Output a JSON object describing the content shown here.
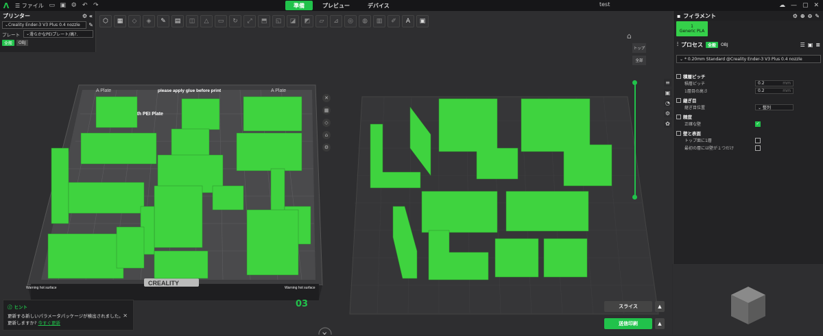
{
  "topbar": {
    "file_menu": "ファイル",
    "tabs": [
      {
        "label": "準備",
        "active": true
      },
      {
        "label": "プレビュー",
        "active": false
      },
      {
        "label": "デバイス",
        "active": false
      }
    ],
    "title": "test"
  },
  "printer": {
    "title": "プリンター",
    "printer_name": "Creality Ender-3 V3 Plus 0.4 nozzle",
    "plate_label": "プレート",
    "plate_value": "滑らかなPEIプレート/高?.",
    "badge_all": "全般",
    "badge_obj": "OBJ"
  },
  "plate": {
    "labels": [
      "A Plate",
      "please apply glue before print",
      "A Plate",
      "Smooth PEI Plate"
    ],
    "brand": "CREALITY",
    "warning_left": "Warning hot surface",
    "warning_right": "Warning hot surface",
    "plate_number": "03"
  },
  "view": {
    "top": "トップ",
    "all": "全部"
  },
  "filament": {
    "title": "フィラメント",
    "slot": "1",
    "name": "Generic PLA"
  },
  "process": {
    "title": "プロセス",
    "badge_all": "全般",
    "badge_obj": "OBJ",
    "preset": "* 0.20mm Standard @Creality Ender-3 V3 Plus 0.4 nozzle",
    "sections": {
      "layer_pitch": "積層ピッチ",
      "seam": "継ぎ目",
      "accuracy": "精度",
      "walls": "壁と表面"
    },
    "layer_height_label": "積層ピッチ",
    "layer_height": "0.2",
    "first_layer_label": "1層目の高さ",
    "first_layer": "0.2",
    "unit": "mm",
    "seam_label": "継ぎ目位置",
    "seam_value": "整列",
    "precise_wall_label": "正確な壁",
    "top_one_wall_label": "トップ面に1層",
    "first_one_wall_label": "最初の層には壁が１つだけ"
  },
  "actions": {
    "slice": "スライス",
    "print": "送信印刷"
  },
  "hint": {
    "title": "ヒント",
    "text1": "更新する新しいパラメータパッケージが検出されました。",
    "text2": "更新しますか?",
    "link": "今すぐ更新"
  },
  "colors": {
    "accent": "#21c24b",
    "part": "#3fd33f"
  }
}
